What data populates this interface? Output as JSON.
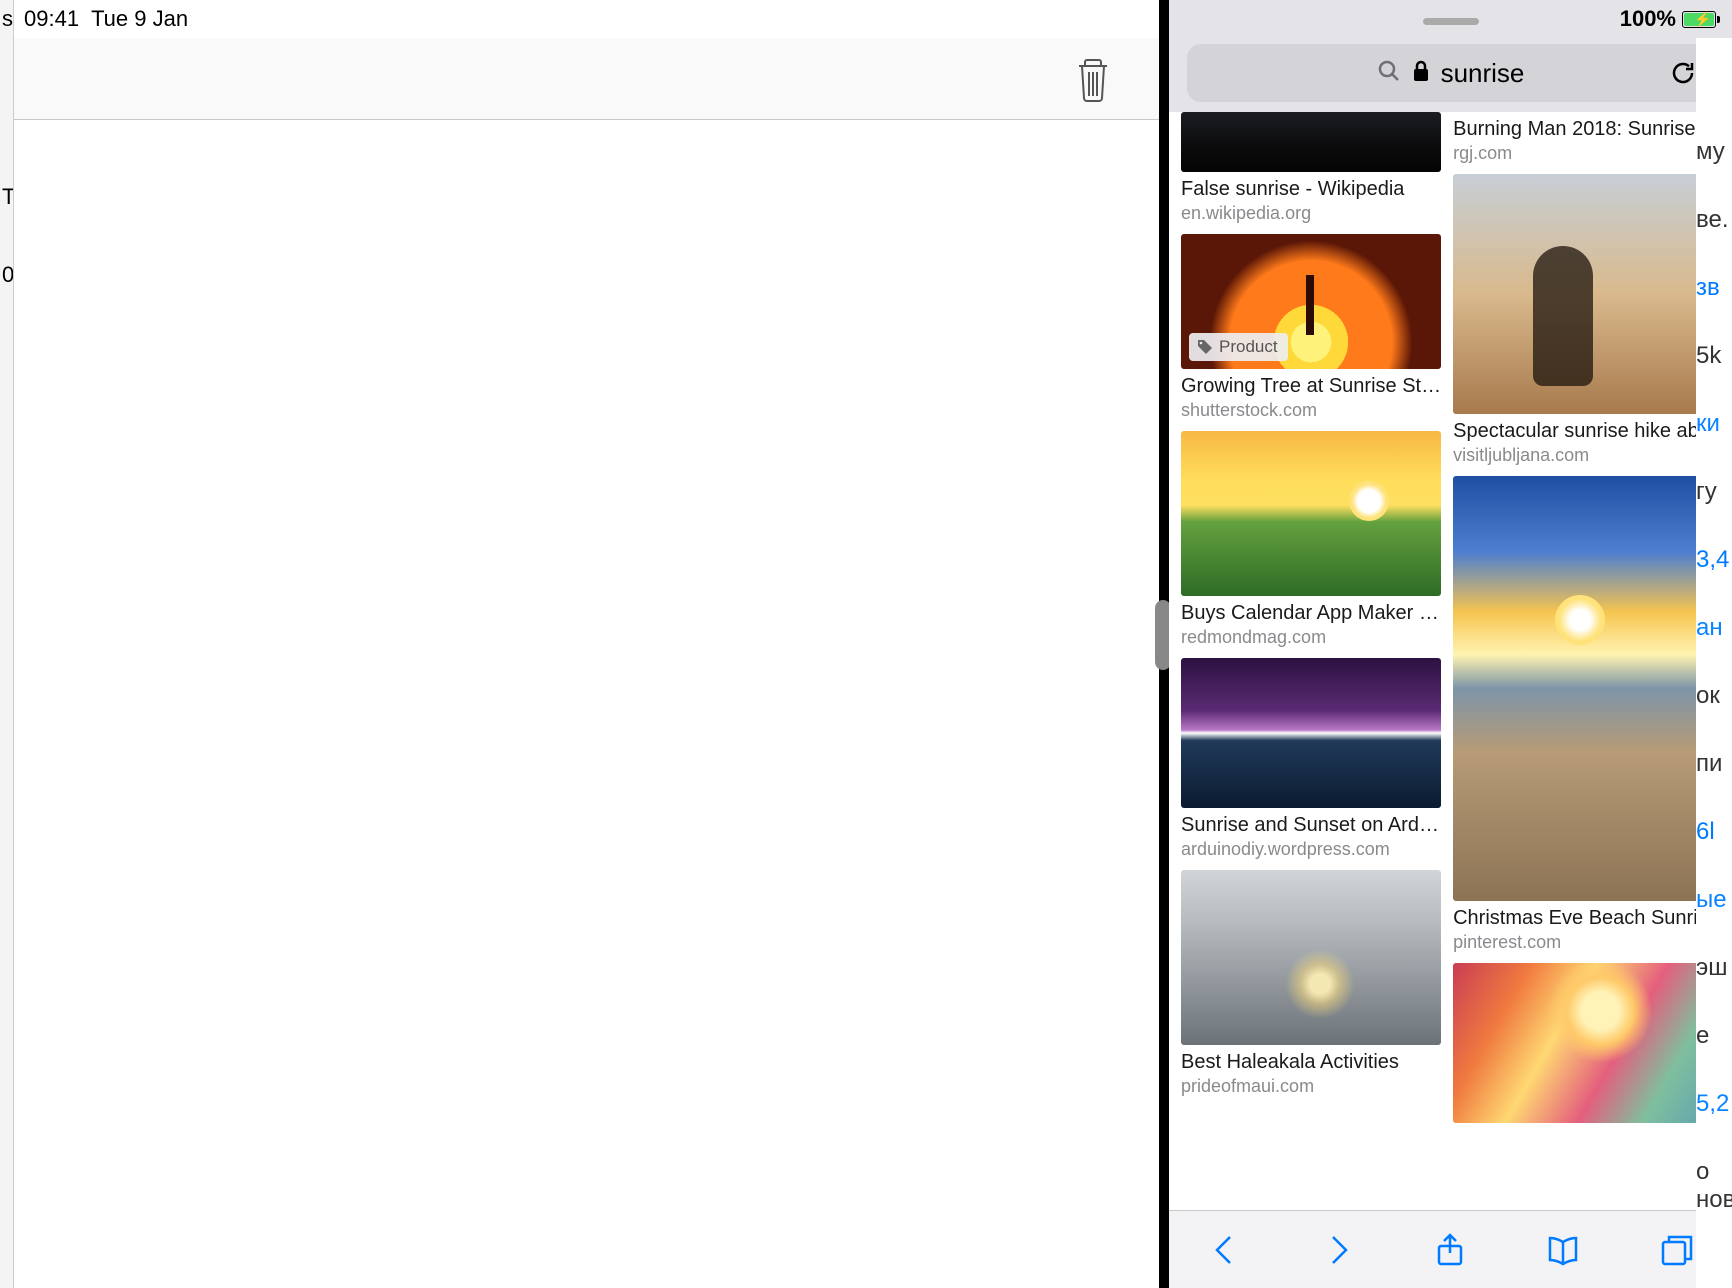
{
  "status": {
    "time": "09:41",
    "date": "Tue 9 Jan",
    "battery_pct": "100%"
  },
  "notes": {
    "edge_items": [
      "s",
      "",
      "T",
      "",
      "0"
    ]
  },
  "safari": {
    "search_text": "sunrise",
    "product_badge": "Product",
    "left_col": [
      {
        "title": "False sunrise - Wikipedia",
        "src": "en.wikipedia.org",
        "thumb_class": "img-falsesunrise",
        "badge": false
      },
      {
        "title": "Growing Tree at Sunrise St…",
        "src": "shutterstock.com",
        "thumb_class": "img-tree",
        "badge": true
      },
      {
        "title": "Buys Calendar App Maker …",
        "src": "redmondmag.com",
        "thumb_class": "img-calendar",
        "badge": false
      },
      {
        "title": "Sunrise and Sunset on Ard…",
        "src": "arduinodiy.wordpress.com",
        "thumb_class": "img-arduino",
        "badge": false
      },
      {
        "title": "Best Haleakala Activities",
        "src": "prideofmaui.com",
        "thumb_class": "img-haleakala",
        "badge": false
      }
    ],
    "right_col": [
      {
        "title": "Burning Man 2018: Sunrise …",
        "src": "rgj.com",
        "thumb_class": "",
        "badge": false,
        "no_thumb": true
      },
      {
        "title": "Spectacular sunrise hike ab…",
        "src": "visitljubljana.com",
        "thumb_class": "img-hike",
        "badge": false
      },
      {
        "title": "Christmas Eve Beach Sunri…",
        "src": "pinterest.com",
        "thumb_class": "img-beach",
        "badge": false
      },
      {
        "title": "",
        "src": "",
        "thumb_class": "img-paint",
        "badge": false
      }
    ]
  },
  "right_edge_fragments": [
    "му",
    "ве.",
    "зв",
    "5k",
    "ки",
    "гу",
    "3,4",
    "ан",
    "ок",
    "пи",
    "6l",
    "ыe",
    "эш",
    "е",
    "5,2",
    "о нови"
  ]
}
